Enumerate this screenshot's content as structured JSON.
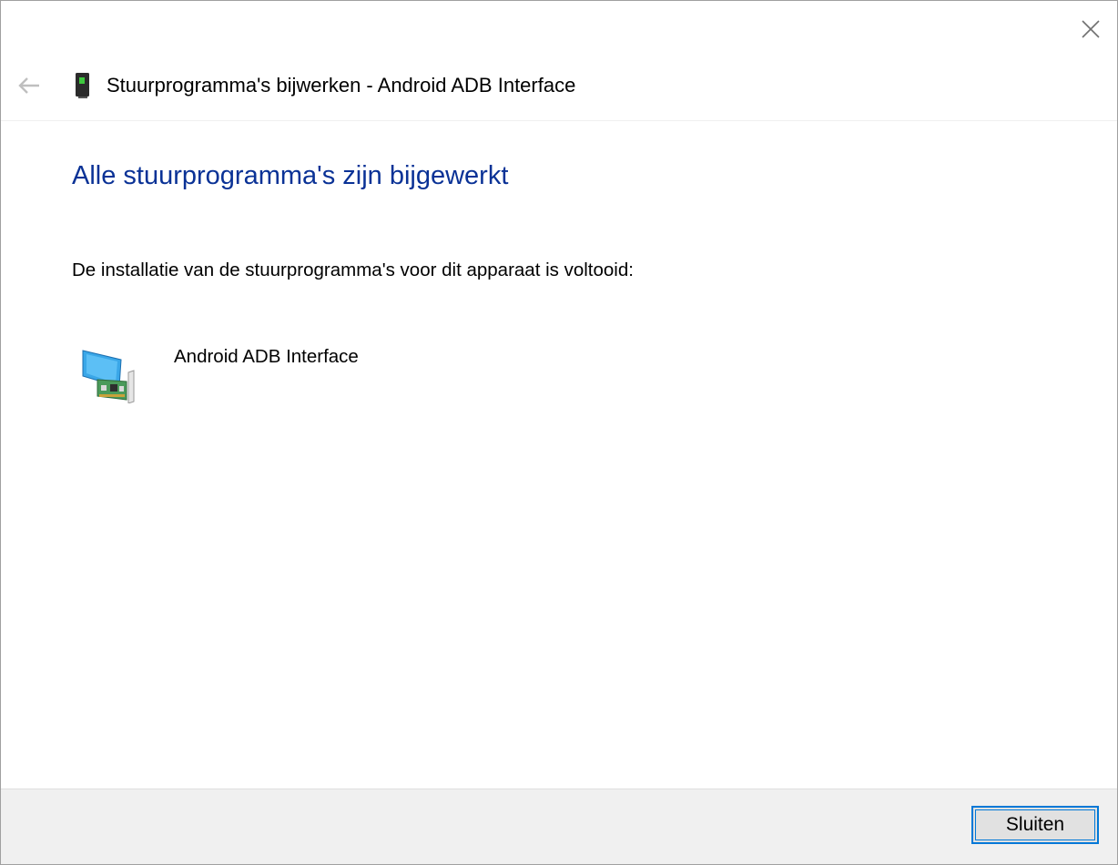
{
  "window": {
    "title": "Stuurprogramma's bijwerken - Android ADB Interface",
    "close_icon": "close-icon",
    "back_icon": "back-arrow-icon",
    "title_icon": "mobile-device-icon"
  },
  "main": {
    "heading": "Alle stuurprogramma's zijn bijgewerkt",
    "description": "De installatie van de stuurprogramma's voor dit apparaat is voltooid:",
    "device": {
      "icon": "network-adapter-icon",
      "name": "Android ADB Interface"
    }
  },
  "footer": {
    "close_label": "Sluiten"
  },
  "colors": {
    "heading": "#0a3296",
    "footer_bg": "#f0f0f0",
    "button_border": "#0078d7"
  }
}
